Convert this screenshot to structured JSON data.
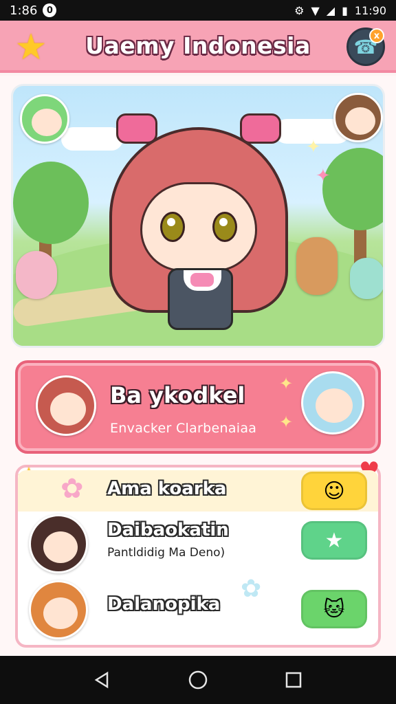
{
  "status_bar": {
    "time_left": "1:86",
    "notification_badge": "0",
    "time_right": "11:90"
  },
  "header": {
    "title": "Uaemy Indonesia",
    "profile_badge": "x",
    "star_icon": "star-icon",
    "profile_icon": "profile-icon"
  },
  "feature": {
    "title": "Ba ykodkel",
    "subtitle": "Envacker Clarbenaiaa"
  },
  "list": {
    "items": [
      {
        "title": "Ama koarka",
        "subtitle": "",
        "button_icon": "smiley-icon"
      },
      {
        "title": "Daibaokatin",
        "subtitle": "Pantldidig Ma Deno)",
        "button_icon": "star-icon"
      },
      {
        "title": "Dalanopika",
        "subtitle": "",
        "button_icon": "cat-icon"
      }
    ]
  },
  "colors": {
    "header": "#f7a3b5",
    "feature_card": "#f67f92",
    "list_border": "#f5b6c4",
    "btn_yellow": "#ffd43b",
    "btn_green": "#5fd38a",
    "btn_green2": "#6bd46b"
  }
}
